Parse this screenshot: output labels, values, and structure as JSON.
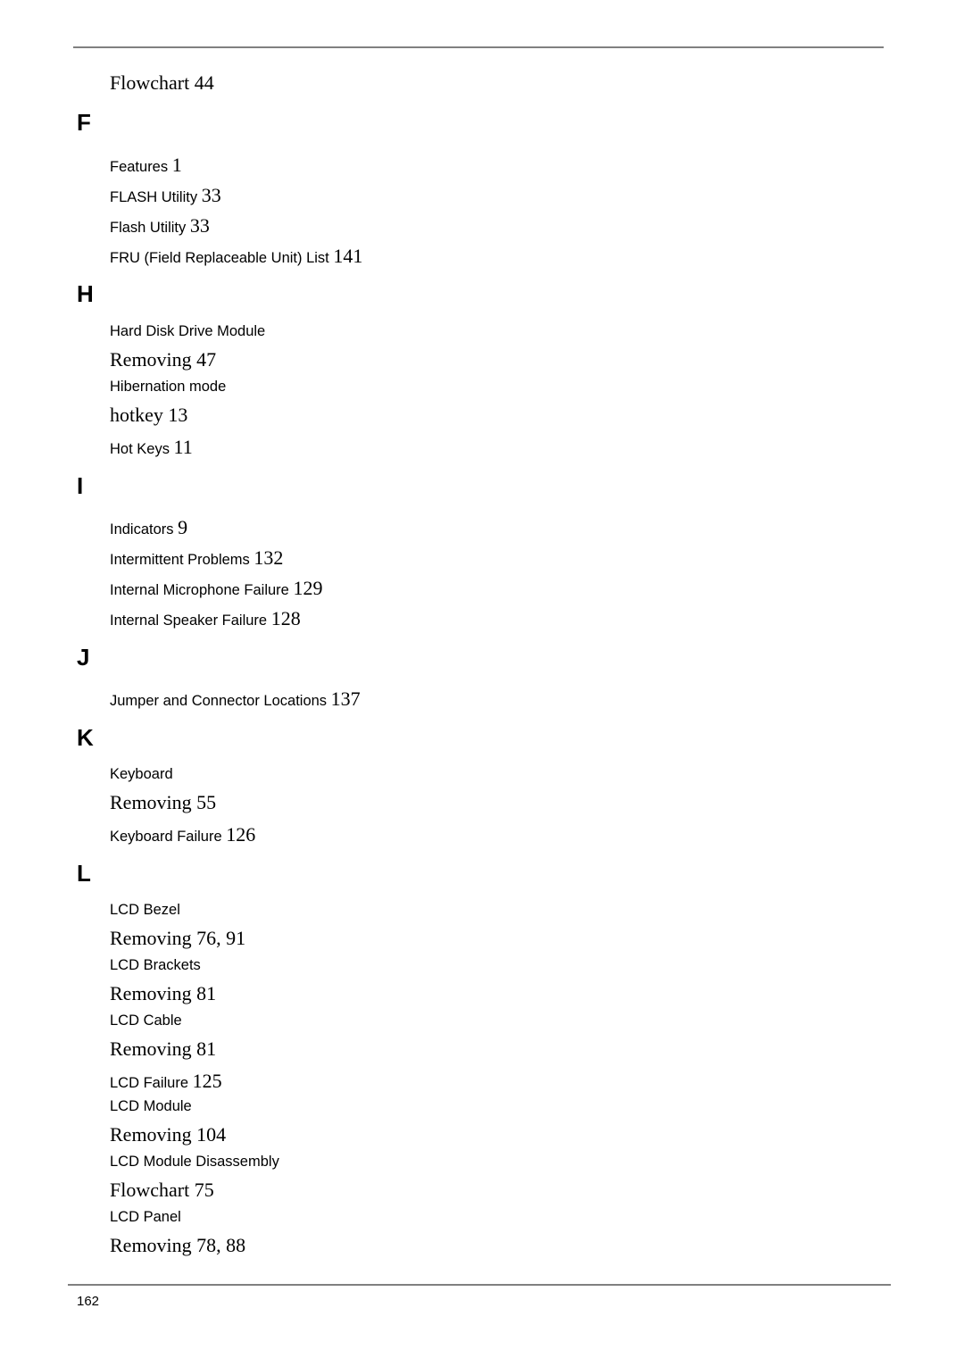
{
  "page_number": "162",
  "items": [
    {
      "text": "Flowchart 44",
      "style": "serif"
    },
    {
      "letter": "F"
    },
    {
      "text": "Features",
      "page": "1"
    },
    {
      "text": "FLASH Utility",
      "page": "33"
    },
    {
      "text": "Flash Utility",
      "page": "33"
    },
    {
      "text": "FRU (Field Replaceable Unit) List",
      "page": "141"
    },
    {
      "letter": "H"
    },
    {
      "text": "Hard Disk Drive Module",
      "page": ""
    },
    {
      "text": "Removing 47",
      "style": "serif"
    },
    {
      "text": "Hibernation mode",
      "page": ""
    },
    {
      "text": "hotkey 13",
      "style": "serif"
    },
    {
      "text": "Hot Keys",
      "page": "11"
    },
    {
      "letter": "I"
    },
    {
      "text": "Indicators",
      "page": "9"
    },
    {
      "text": "Intermittent Problems",
      "page": "132"
    },
    {
      "text": "Internal Microphone Failure",
      "page": "129"
    },
    {
      "text": "Internal Speaker Failure",
      "page": "128"
    },
    {
      "letter": "J"
    },
    {
      "text": "Jumper and Connector Locations",
      "page": "137"
    },
    {
      "letter": "K"
    },
    {
      "text": "Keyboard",
      "page": ""
    },
    {
      "text": "Removing 55",
      "style": "serif"
    },
    {
      "text": "Keyboard Failure",
      "page": "126"
    },
    {
      "letter": "L"
    },
    {
      "text": "LCD Bezel",
      "page": ""
    },
    {
      "text": "Removing 76, 91",
      "style": "serif"
    },
    {
      "text": "LCD Brackets",
      "page": ""
    },
    {
      "text": "Removing 81",
      "style": "serif"
    },
    {
      "text": "LCD Cable",
      "page": ""
    },
    {
      "text": "Removing 81",
      "style": "serif"
    },
    {
      "text": "LCD Failure",
      "page": "125"
    },
    {
      "text": "LCD Module",
      "page": ""
    },
    {
      "text": "Removing 104",
      "style": "serif"
    },
    {
      "text": "LCD Module Disassembly",
      "page": ""
    },
    {
      "text": "Flowchart 75",
      "style": "serif"
    },
    {
      "text": "LCD Panel",
      "page": ""
    },
    {
      "text": "Removing 78, 88",
      "style": "serif"
    }
  ]
}
